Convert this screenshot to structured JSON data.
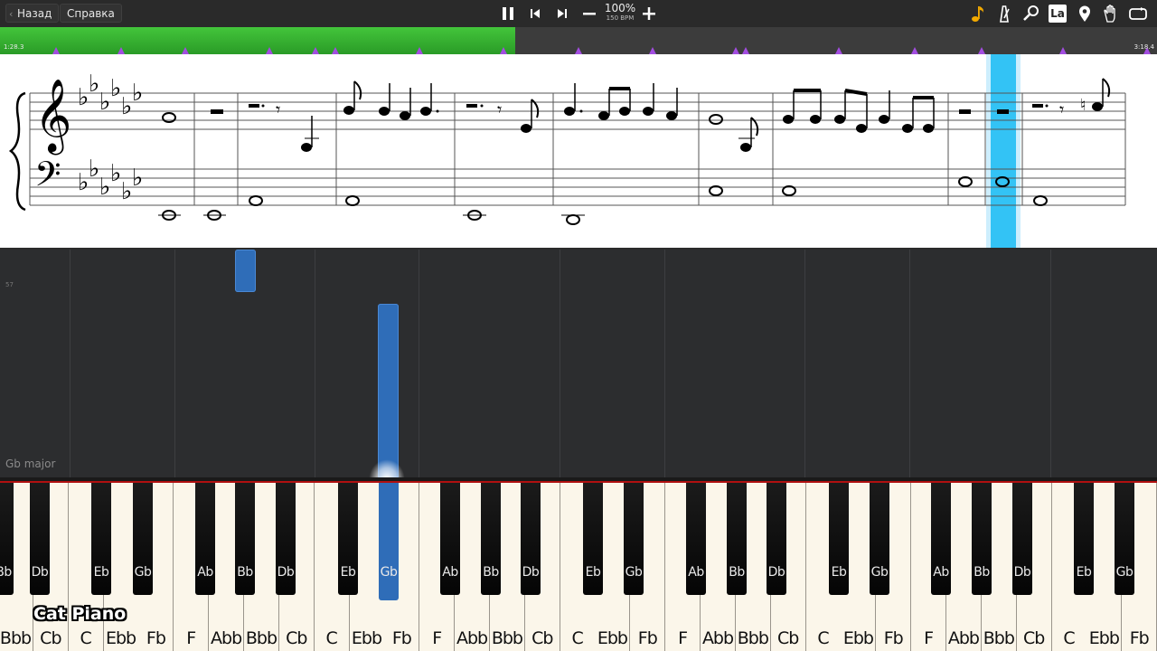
{
  "toolbar": {
    "back_label": "Назад",
    "help_label": "Справка",
    "zoom_text": "100%",
    "tempo_text": "150 BPM"
  },
  "timeline": {
    "elapsed": "1:28.3",
    "total": "3:18.4",
    "played_fraction": 0.445
  },
  "colors": {
    "accent_blue": "#2f6db8",
    "playhead_blue": "#33c3f5",
    "progress_green": "#3cbd34",
    "marker_purple": "#a24de0"
  },
  "roll": {
    "key_signature_name": "Gb major",
    "pitch_marker": "57"
  },
  "keyboard": {
    "white_keys": [
      "Bbb",
      "Cb",
      "C",
      "Ebb",
      "Fb",
      "F",
      "Abb",
      "Bbb",
      "Cb",
      "C",
      "Ebb",
      "Fb",
      "F",
      "Abb",
      "Bbb",
      "Cb",
      "C",
      "Ebb",
      "Fb",
      "F",
      "Abb",
      "Bbb",
      "Cb",
      "C",
      "Ebb",
      "Fb",
      "F",
      "Abb",
      "Bbb",
      "Cb",
      "C",
      "Ebb",
      "Fb"
    ],
    "black_keys": [
      "Bb",
      "Db",
      "Eb",
      "Gb",
      "Ab",
      "Bb",
      "Db",
      "Eb",
      "Gb",
      "Ab",
      "Bb",
      "Db",
      "Eb",
      "Gb",
      "Ab",
      "Bb",
      "Db",
      "Eb",
      "Gb",
      "Ab",
      "Bb",
      "Db",
      "Eb",
      "Gb",
      "Ab",
      "Bb",
      "Db",
      "Eb"
    ],
    "pressed_key": "Eb"
  },
  "branding": {
    "logo_text": "Cat Piano"
  },
  "icons": [
    "pause-icon",
    "skip-back-icon",
    "skip-forward-icon",
    "minus-icon",
    "plus-icon",
    "note-icon",
    "metronome-icon",
    "search-icon",
    "la-icon",
    "location-icon",
    "hand-icon",
    "loop-icon"
  ],
  "icon_labels": {
    "la": "La"
  }
}
